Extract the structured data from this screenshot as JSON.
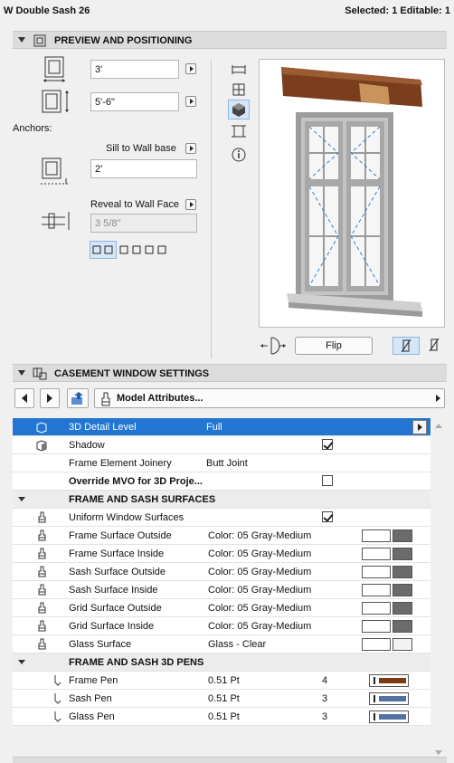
{
  "titlebar": {
    "title": "W Double Sash 26",
    "status": "Selected: 1 Editable: 1"
  },
  "preview_section": {
    "header": "PREVIEW AND POSITIONING",
    "width_value": "3'",
    "height_value": "5'-6\"",
    "anchors_label": "Anchors:",
    "sill_anchor_label": "Sill to Wall base",
    "sill_value": "2'",
    "reveal_label": "Reveal to Wall Face",
    "reveal_value": "3 5/8\"",
    "flip_label": "Flip"
  },
  "casement_section": {
    "header": "CASEMENT WINDOW SETTINGS",
    "attributes_label": "Model Attributes..."
  },
  "rows": [
    {
      "label": "3D Detail Level",
      "value": "Full"
    },
    {
      "label": "Shadow",
      "value": ""
    },
    {
      "label": "Frame Element Joinery",
      "value": "Butt Joint"
    },
    {
      "label": "Override MVO for 3D Proje...",
      "value": ""
    }
  ],
  "surfaces_header": "FRAME AND SASH SURFACES",
  "surfaces": [
    {
      "label": "Uniform Window Surfaces",
      "value": ""
    },
    {
      "label": "Frame Surface Outside",
      "value": "Color: 05 Gray-Medium"
    },
    {
      "label": "Frame Surface Inside",
      "value": "Color: 05 Gray-Medium"
    },
    {
      "label": "Sash Surface Outside",
      "value": "Color: 05 Gray-Medium"
    },
    {
      "label": "Sash Surface Inside",
      "value": "Color: 05 Gray-Medium"
    },
    {
      "label": "Grid Surface Outside",
      "value": "Color: 05 Gray-Medium"
    },
    {
      "label": "Grid Surface Inside",
      "value": "Color: 05 Gray-Medium"
    },
    {
      "label": "Glass Surface",
      "value": "Glass - Clear"
    }
  ],
  "pens_header": "FRAME AND SASH 3D PENS",
  "pens": [
    {
      "label": "Frame Pen",
      "value": "0.51 Pt",
      "num": "4",
      "color": "#7a3b12"
    },
    {
      "label": "Sash Pen",
      "value": "0.51 Pt",
      "num": "3",
      "color": "#5470a0"
    },
    {
      "label": "Glass Pen",
      "value": "0.51 Pt",
      "num": "3",
      "color": "#5470a0"
    }
  ],
  "colors": {
    "selection": "#2276d2",
    "swatch_gray": "#6b6b6b",
    "glass": "#f2f2f2"
  }
}
